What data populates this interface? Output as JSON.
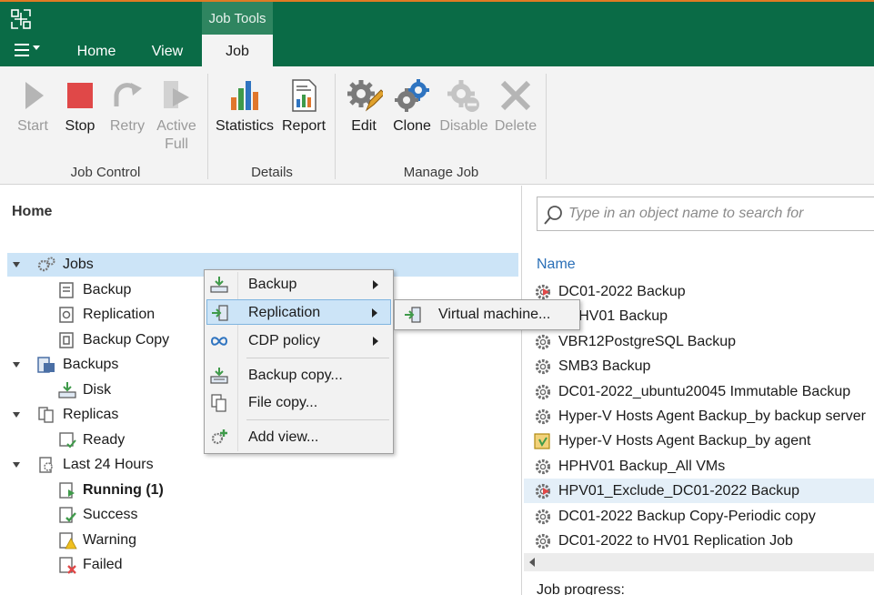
{
  "tabbar": {
    "context_group": "Job Tools",
    "tabs": [
      {
        "label": "Home"
      },
      {
        "label": "View"
      },
      {
        "label": "Job"
      }
    ]
  },
  "ribbon": {
    "groups": [
      {
        "label": "Job Control",
        "buttons": [
          {
            "label": "Start",
            "disabled": true
          },
          {
            "label": "Stop",
            "disabled": false
          },
          {
            "label": "Retry",
            "disabled": true
          },
          {
            "label": "Active",
            "label2": "Full",
            "disabled": true
          }
        ]
      },
      {
        "label": "Details",
        "buttons": [
          {
            "label": "Statistics",
            "disabled": false
          },
          {
            "label": "Report",
            "disabled": false
          }
        ]
      },
      {
        "label": "Manage Job",
        "buttons": [
          {
            "label": "Edit",
            "disabled": false
          },
          {
            "label": "Clone",
            "disabled": false
          },
          {
            "label": "Disable",
            "disabled": true
          },
          {
            "label": "Delete",
            "disabled": true
          }
        ]
      }
    ]
  },
  "nav": {
    "title": "Home",
    "tree": [
      {
        "label": "Jobs",
        "icon": "gears-icon"
      },
      {
        "label": "Backup",
        "icon": "backup-job-icon"
      },
      {
        "label": "Replication",
        "icon": "replication-job-icon"
      },
      {
        "label": "Backup Copy",
        "icon": "backup-copy-job-icon"
      },
      {
        "label": "Backups",
        "icon": "backups-icon"
      },
      {
        "label": "Disk",
        "icon": "disk-icon"
      },
      {
        "label": "Replicas",
        "icon": "replicas-icon"
      },
      {
        "label": "Ready",
        "icon": "ready-icon"
      },
      {
        "label": "Last 24 Hours",
        "icon": "last-24-hours-icon"
      },
      {
        "label": "Running (1)",
        "icon": "running-icon"
      },
      {
        "label": "Success",
        "icon": "success-icon"
      },
      {
        "label": "Warning",
        "icon": "warning-icon"
      },
      {
        "label": "Failed",
        "icon": "failed-icon"
      }
    ]
  },
  "context_menu": {
    "items": [
      {
        "label": "Backup",
        "icon": "backup-icon"
      },
      {
        "label": "Replication",
        "icon": "replication-icon"
      },
      {
        "label": "CDP policy",
        "icon": "cdp-infinity-icon"
      },
      {
        "label": "Backup copy...",
        "icon": "backup-copy-icon"
      },
      {
        "label": "File copy...",
        "icon": "file-copy-icon"
      },
      {
        "label": "Add view...",
        "icon": "add-view-icon"
      }
    ],
    "submenu": [
      {
        "label": "Virtual machine...",
        "icon": "virtual-machine-icon"
      }
    ]
  },
  "right": {
    "search_placeholder": "Type in an object name to search for",
    "column_name": "Name",
    "jobs": [
      {
        "name": "DC01-2022 Backup",
        "icon": "gear-running-icon"
      },
      {
        "name": "HPHV01 Backup",
        "icon": "gear-icon"
      },
      {
        "name": "VBR12PostgreSQL Backup",
        "icon": "gear-icon"
      },
      {
        "name": "SMB3 Backup",
        "icon": "gear-icon"
      },
      {
        "name": "DC01-2022_ubuntu20045 Immutable Backup",
        "icon": "gear-icon"
      },
      {
        "name": "Hyper-V Hosts Agent Backup_by backup server",
        "icon": "gear-icon"
      },
      {
        "name": "Hyper-V Hosts Agent Backup_by agent",
        "icon": "agent-job-icon"
      },
      {
        "name": "HPHV01 Backup_All VMs",
        "icon": "gear-icon"
      },
      {
        "name": "HPV01_Exclude_DC01-2022 Backup",
        "icon": "gear-running-icon"
      },
      {
        "name": "DC01-2022 Backup Copy-Periodic copy",
        "icon": "gear-icon"
      },
      {
        "name": "DC01-2022 to HV01 Replication Job",
        "icon": "gear-icon"
      }
    ],
    "progress_label": "Job progress:"
  },
  "colors": {
    "brand_green": "#0a6b46",
    "context_tab": "#2f8560",
    "selection": "#cce4f7",
    "link_blue": "#2a6fb7",
    "stop_red": "#e04848"
  }
}
